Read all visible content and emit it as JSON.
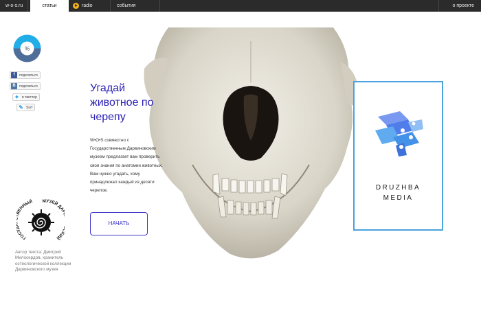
{
  "topbar": {
    "site": "w-o-s.ru",
    "articles": "статьи",
    "radio": "radio",
    "events": "события",
    "about": "о проекте"
  },
  "gauge": {
    "label": "%",
    "fill_fraction": 0.5,
    "color_top": "#21aee8",
    "color_bottom": "#4f6d99"
  },
  "share": {
    "facebook": "поделиться",
    "vk": "поделиться",
    "twitter": "в твиттер",
    "surf": "Surf"
  },
  "article": {
    "title_line1": "Угадай",
    "title_line2": "животное по",
    "title_line3": "черепу",
    "desc_line1": "W•O•S совместно с",
    "desc_line2": "Государственным Дарвиновским",
    "desc_line3": "музеем предлагает вам проверить",
    "desc_line4": "свои знания по анатомии животных.",
    "desc_line5": "Вам нужно угадать, кому",
    "desc_line6": "принадлежал каждый из десяти",
    "desc_line7": "черепов.",
    "start_button": "НАЧАТЬ"
  },
  "sponsor": {
    "name_line1": "DRUZHBA",
    "name_line2": "MEDIA",
    "border_color": "#4aa2df"
  },
  "museum": {
    "logo_text_left": "ГОСУДАРСТВЕННЫЙ",
    "logo_text_right": "МУЗЕЙ ДАРВИНОВСКИЙ"
  },
  "author": {
    "line1": "Автор текста: Дмитрий",
    "line2": "Милосердов, хранитель",
    "line3": "остеологической коллекции",
    "line4": "Дарвиновского музея"
  },
  "colors": {
    "accent": "#2a1fb5",
    "topbar": "#2b2b2b",
    "radio_icon": "#f2b01e"
  }
}
